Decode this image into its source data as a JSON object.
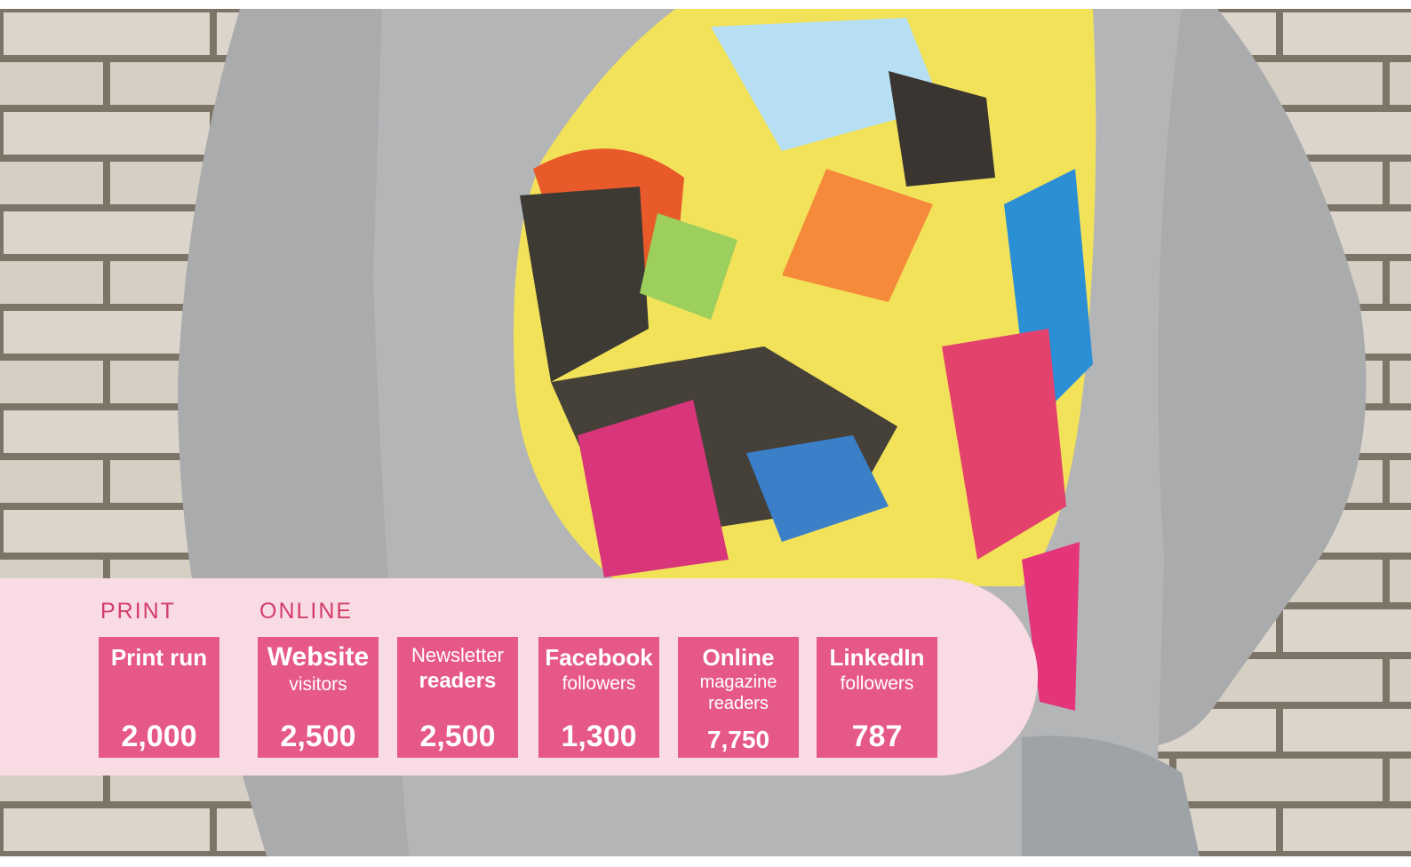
{
  "categories": {
    "print": "PRINT",
    "online": "ONLINE"
  },
  "stats": [
    {
      "lines": [
        "Print run"
      ],
      "value": "2,000"
    },
    {
      "lines": [
        "Website",
        "visitors"
      ],
      "value": "2,500"
    },
    {
      "lines": [
        "Newsletter",
        "readers"
      ],
      "value": "2,500"
    },
    {
      "lines": [
        "Facebook",
        "followers"
      ],
      "value": "1,300"
    },
    {
      "lines": [
        "Online",
        "magazine",
        "readers"
      ],
      "value": "7,750"
    },
    {
      "lines": [
        "LinkedIn",
        "followers"
      ],
      "value": "787"
    }
  ],
  "colors": {
    "accent": "#e65888",
    "panel": "#f9dbe4",
    "label": "#d33c6c"
  }
}
